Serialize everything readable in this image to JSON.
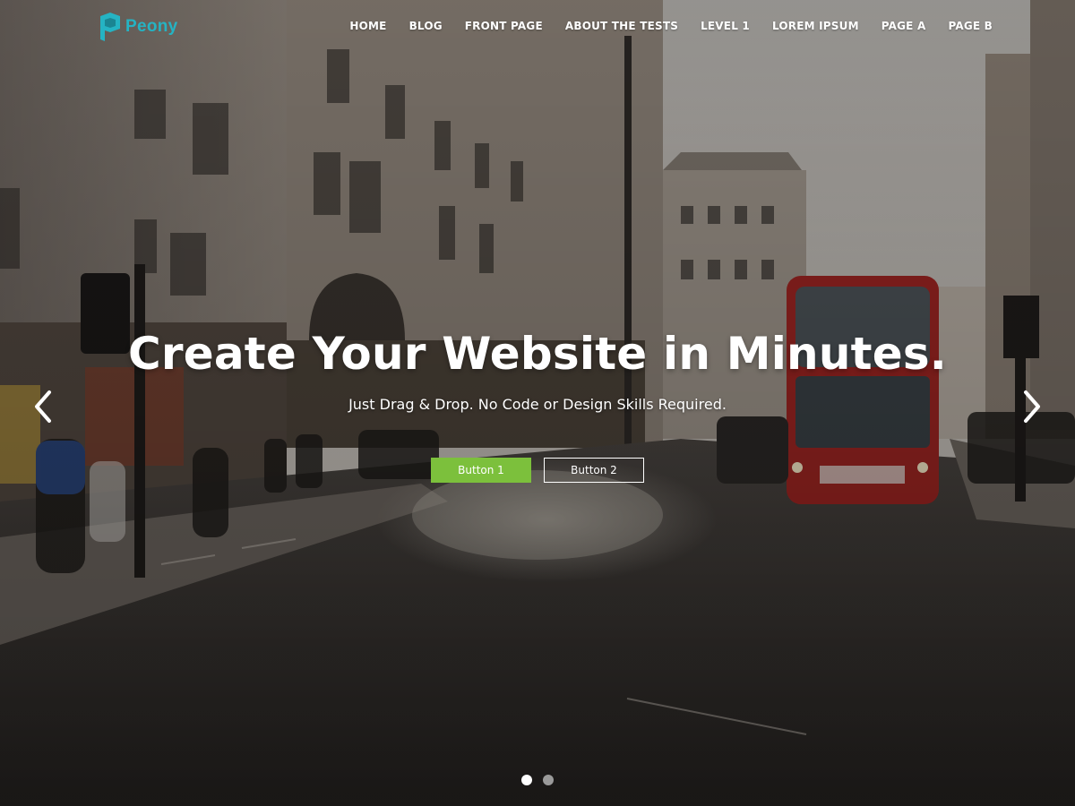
{
  "brand": {
    "name": "Peony",
    "logo_icon": "peony-logo-icon",
    "color": "#25b3c3"
  },
  "nav": {
    "items": [
      {
        "label": "HOME"
      },
      {
        "label": "BLOG"
      },
      {
        "label": "FRONT PAGE"
      },
      {
        "label": "ABOUT THE TESTS"
      },
      {
        "label": "LEVEL 1"
      },
      {
        "label": "LOREM IPSUM"
      },
      {
        "label": "PAGE A"
      },
      {
        "label": "PAGE B"
      }
    ]
  },
  "hero": {
    "headline": "Create Your Website in Minutes.",
    "subheadline": "Just Drag & Drop. No Code or Design Skills Required.",
    "button1": {
      "label": "Button 1",
      "color": "#7cc03c"
    },
    "button2": {
      "label": "Button 2"
    },
    "prev_icon": "chevron-left-icon",
    "next_icon": "chevron-right-icon",
    "slides": {
      "count": 2,
      "active_index": 1
    }
  }
}
